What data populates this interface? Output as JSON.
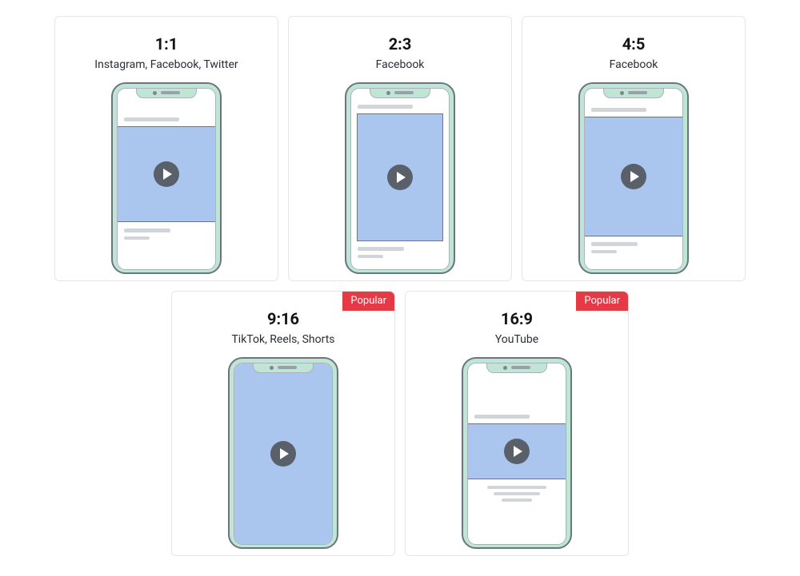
{
  "badge_label": "Popular",
  "cards": [
    {
      "ratio": "1:1",
      "platforms": "Instagram, Facebook, Twitter",
      "popular": false,
      "aspect": "1:1"
    },
    {
      "ratio": "2:3",
      "platforms": "Facebook",
      "popular": false,
      "aspect": "2:3"
    },
    {
      "ratio": "4:5",
      "platforms": "Facebook",
      "popular": false,
      "aspect": "4:5"
    },
    {
      "ratio": "9:16",
      "platforms": "TikTok, Reels, Shorts",
      "popular": true,
      "aspect": "9:16"
    },
    {
      "ratio": "16:9",
      "platforms": "YouTube",
      "popular": true,
      "aspect": "16:9"
    }
  ]
}
